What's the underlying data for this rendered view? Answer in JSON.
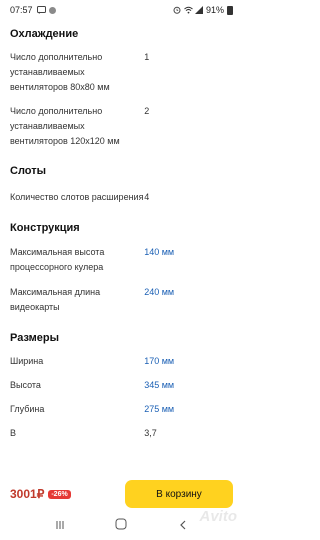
{
  "status_bar": {
    "time": "07:57",
    "battery": "91%",
    "icons": [
      "sms-icon",
      "avatar-icon",
      "alarm-icon",
      "wifi-icon",
      "signal-icon",
      "battery-icon"
    ]
  },
  "sections": [
    {
      "title": "Охлаждение",
      "rows": [
        {
          "label": "Число дополнительно устанавливаемых вентиляторов 80x80 мм",
          "value": "1",
          "accent": false
        },
        {
          "label": "Число дополнительно устанавливаемых вентиляторов 120x120 мм",
          "value": "2",
          "accent": false
        }
      ]
    },
    {
      "title": "Слоты",
      "rows": [
        {
          "label": "Количество слотов расширения",
          "value": "4",
          "accent": false
        }
      ]
    },
    {
      "title": "Конструкция",
      "rows": [
        {
          "label": "Максимальная высота процессорного кулера",
          "value": "140 мм",
          "accent": true
        },
        {
          "label": "Максимальная длина видеокарты",
          "value": "240 мм",
          "accent": true
        }
      ]
    },
    {
      "title": "Размеры",
      "rows": [
        {
          "label": "Ширина",
          "value": "170 мм",
          "accent": true
        },
        {
          "label": "Высота",
          "value": "345 мм",
          "accent": true
        },
        {
          "label": "Глубина",
          "value": "275 мм",
          "accent": true
        },
        {
          "label": "В",
          "value": "3,7",
          "accent": false
        }
      ]
    }
  ],
  "bottom_bar": {
    "price": "3001₽",
    "discount": "-26%",
    "cart_label": "В корзину"
  },
  "watermark": "Avito",
  "colors": {
    "accent_blue": "#1a5fb4",
    "cart_yellow": "#ffd21f",
    "discount_red": "#e53935",
    "price_red": "#c0392b"
  }
}
